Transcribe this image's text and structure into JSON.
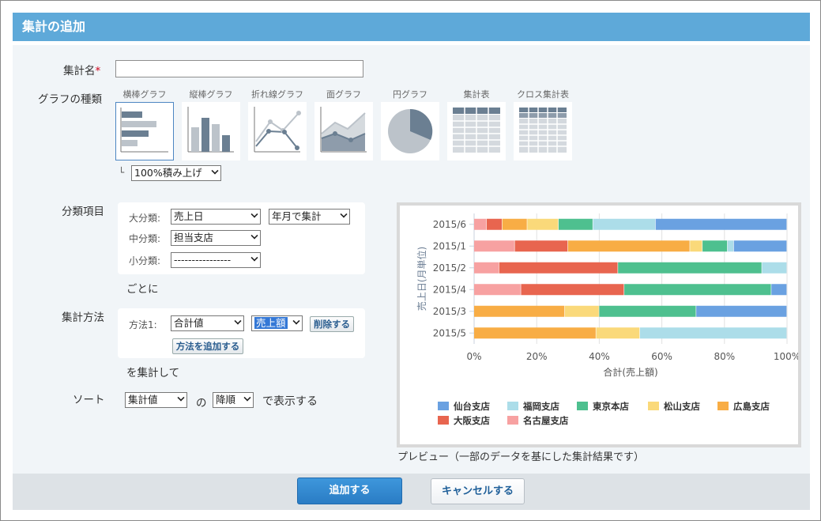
{
  "dialog": {
    "title": "集計の追加"
  },
  "form": {
    "name_label": "集計名",
    "required_mark": "*",
    "name_value": "",
    "graph_type_label": "グラフの種類",
    "graph_types": [
      {
        "label": "横棒グラフ",
        "icon": "horizontal-bar-icon"
      },
      {
        "label": "縦棒グラフ",
        "icon": "vertical-bar-icon"
      },
      {
        "label": "折れ線グラフ",
        "icon": "line-chart-icon"
      },
      {
        "label": "面グラフ",
        "icon": "area-chart-icon"
      },
      {
        "label": "円グラフ",
        "icon": "pie-chart-icon"
      },
      {
        "label": "集計表",
        "icon": "table-icon"
      },
      {
        "label": "クロス集計表",
        "icon": "cross-table-icon"
      }
    ],
    "tree_glyph": "└",
    "stack_mode": "100%積み上げ",
    "category_label": "分類項目",
    "major_label": "大分類:",
    "major_value": "売上日",
    "major_group": "年月で集計",
    "mid_label": "中分類:",
    "mid_value": "担当支店",
    "minor_label": "小分類:",
    "minor_value": "----------------",
    "per_text": "ごとに",
    "method_label": "集計方法",
    "method1_label": "方法1:",
    "method1_func": "合計値",
    "method1_field": "売上額",
    "delete_button": "削除する",
    "add_method_button": "方法を追加する",
    "aggregate_text": "を集計して",
    "sort_label": "ソート",
    "sort_by": "集計値",
    "sort_of": "の",
    "sort_order": "降順",
    "sort_suffix": "で表示する",
    "preview_caption": "プレビュー（一部のデータを基にした集計結果です）"
  },
  "footer": {
    "add_button": "追加する",
    "cancel_button": "キャンセルする"
  },
  "chart_data": {
    "type": "bar",
    "orientation": "horizontal",
    "stacked": "100%",
    "categories": [
      "2015/6",
      "2015/1",
      "2015/2",
      "2015/4",
      "2015/3",
      "2015/5"
    ],
    "xlabel": "合計(売上額)",
    "ylabel": "売上日(月単位)",
    "xlim": [
      0,
      100
    ],
    "x_ticks": [
      "0%",
      "20%",
      "40%",
      "60%",
      "80%",
      "100%"
    ],
    "legend_position": "bottom",
    "series": [
      {
        "name": "名古屋支店",
        "color": "#f7a1a1",
        "values": [
          4,
          13,
          8,
          15,
          0,
          0
        ]
      },
      {
        "name": "大阪支店",
        "color": "#e8654f",
        "values": [
          5,
          17,
          38,
          33,
          0,
          0
        ]
      },
      {
        "name": "広島支店",
        "color": "#f8ad45",
        "values": [
          8,
          39,
          0,
          0,
          29,
          39
        ]
      },
      {
        "name": "松山支店",
        "color": "#fad97a",
        "values": [
          10,
          4,
          0,
          0,
          11,
          14
        ]
      },
      {
        "name": "東京本店",
        "color": "#4ec08f",
        "values": [
          11,
          8,
          46,
          47,
          31,
          0
        ]
      },
      {
        "name": "福岡支店",
        "color": "#acdde9",
        "values": [
          20,
          2,
          8,
          0,
          0,
          47
        ]
      },
      {
        "name": "仙台支店",
        "color": "#6aa1e1",
        "values": [
          42,
          17,
          0,
          5,
          29,
          0
        ]
      }
    ],
    "legend_order": [
      "仙台支店",
      "福岡支店",
      "東京本店",
      "松山支店",
      "広島支店",
      "大阪支店",
      "名古屋支店"
    ]
  }
}
